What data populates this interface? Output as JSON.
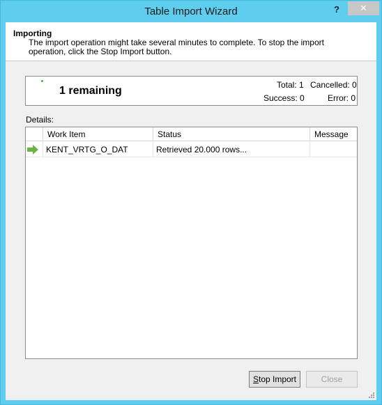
{
  "window": {
    "title": "Table Import Wizard",
    "help_label": "?",
    "close_label": "✕"
  },
  "header": {
    "title": "Importing",
    "description": "The import operation might take several minutes to complete. To stop the import operation, click the Stop Import button."
  },
  "progress": {
    "remaining_text": "1 remaining",
    "total": "Total: 1",
    "cancelled": "Cancelled: 0",
    "success": "Success: 0",
    "error": "Error: 0"
  },
  "details": {
    "label": "Details:",
    "columns": [
      "Work Item",
      "Status",
      "Message"
    ],
    "rows": [
      {
        "icon": "right-arrow-icon",
        "work_item": "KENT_VRTG_O_DAT",
        "status": "Retrieved 20.000 rows...",
        "message": ""
      }
    ]
  },
  "buttons": {
    "stop_mnemonic": "S",
    "stop_rest": "top Import",
    "close": "Close"
  },
  "colors": {
    "titlebar": "#5fcdee",
    "progress_dot": "#3db43d",
    "arrow": "#6db33f"
  }
}
